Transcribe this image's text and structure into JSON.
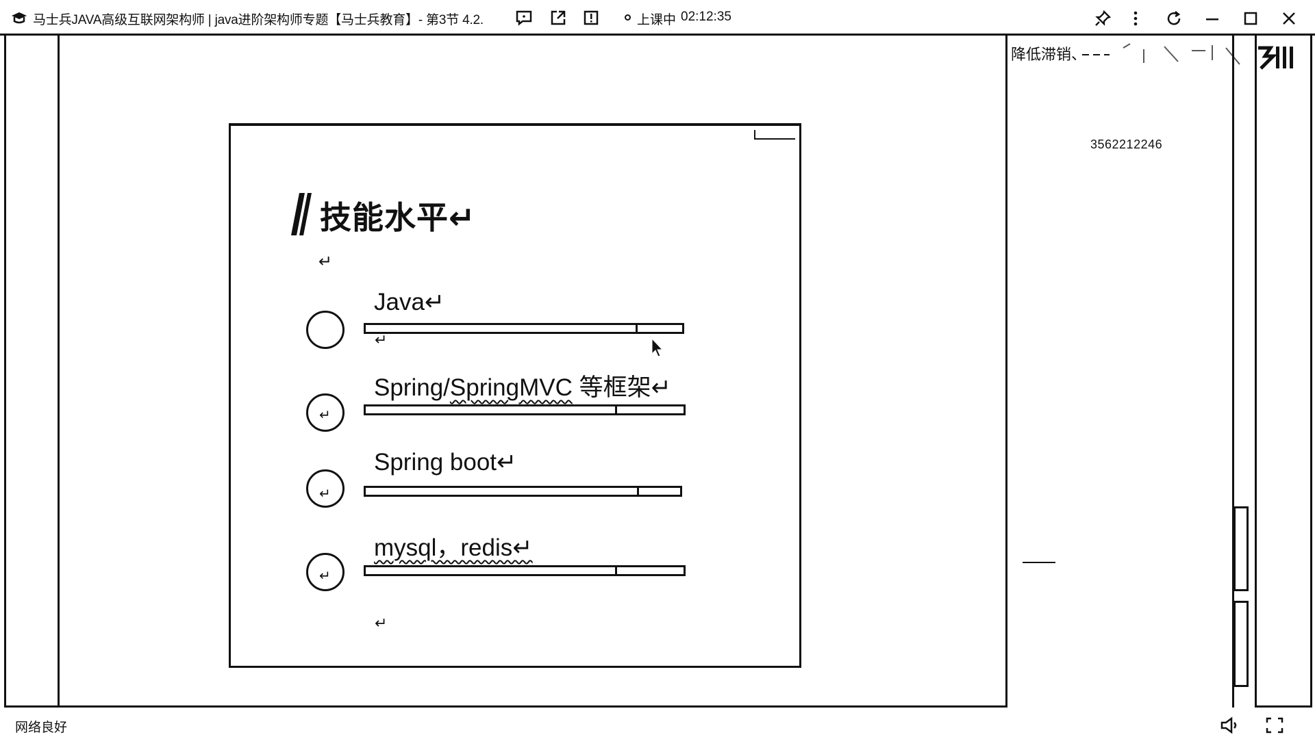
{
  "titlebar": {
    "app_icon": "graduation-cap-icon",
    "title": "马士兵JAVA高级互联网架构师 | java进阶架构师专题【马士兵教育】- 第3节 4.2.",
    "icons": [
      "comment-icon",
      "popout-icon",
      "info-icon"
    ],
    "status": "上课中",
    "time": "02:12:35",
    "window_controls": [
      "pin-icon",
      "more-icon",
      "refresh-icon",
      "minimize-icon",
      "maximize-icon",
      "close-icon"
    ]
  },
  "slide": {
    "title": "技能水平↵",
    "blank_line": "↵",
    "skills": [
      {
        "label": "Java↵",
        "level": 0.86,
        "after": "↵"
      },
      {
        "label": "Spring/SpringMVC 等框架↵",
        "level": 0.79
      },
      {
        "label": "Spring boot↵",
        "level": 0.87
      },
      {
        "label": "mysql，redis↵",
        "level": 0.79
      }
    ],
    "trailing": "↵"
  },
  "side": {
    "top_text": "降低滞销、",
    "user_id": "3562212246"
  },
  "bottom": {
    "network_status": "网络良好",
    "icons": [
      "volume-icon",
      "fullscreen-icon"
    ]
  }
}
